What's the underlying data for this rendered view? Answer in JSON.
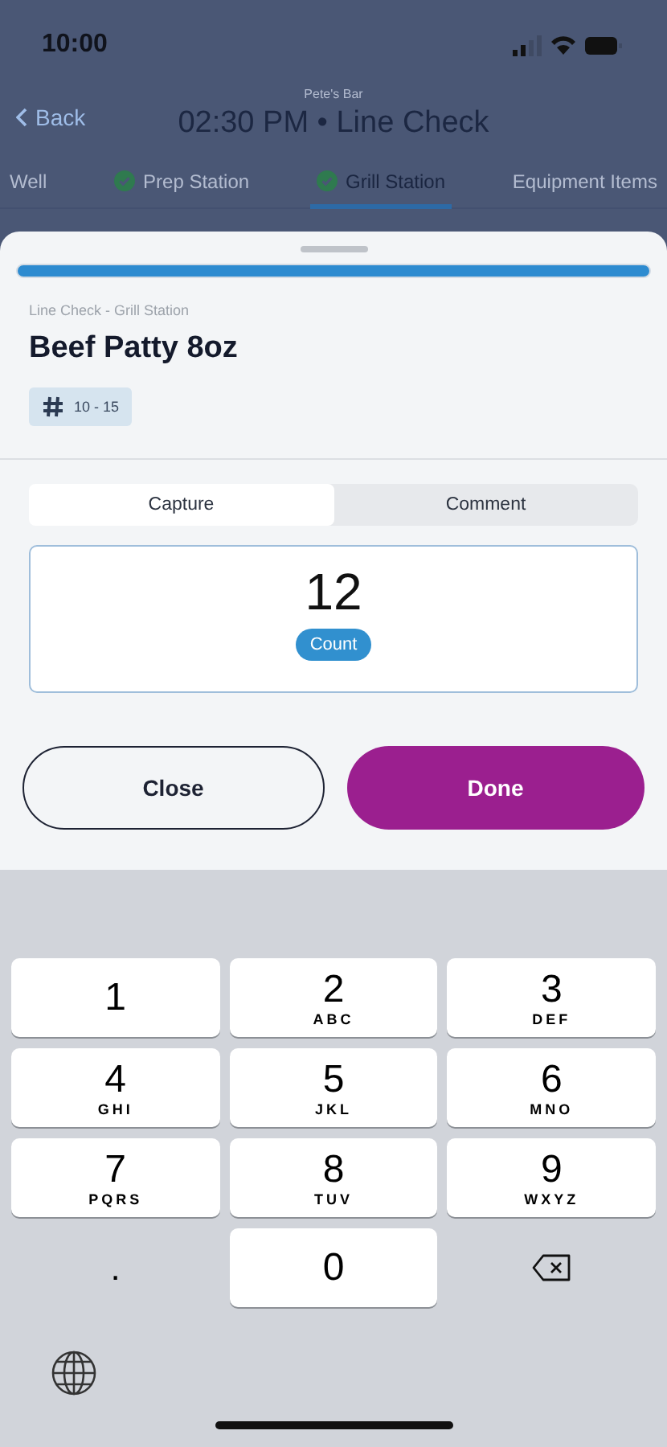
{
  "status_bar": {
    "time": "10:00"
  },
  "header": {
    "venue": "Pete's Bar",
    "back": "Back",
    "title": "02:30 PM • Line Check"
  },
  "tabs": [
    {
      "label": "Well",
      "done": false,
      "selected": false
    },
    {
      "label": "Prep Station",
      "done": true,
      "selected": false
    },
    {
      "label": "Grill Station",
      "done": true,
      "selected": true
    },
    {
      "label": "Equipment Items",
      "done": false,
      "selected": false
    }
  ],
  "sheet": {
    "progress": {
      "level": 1
    },
    "breadcrumb": "Line Check - Grill Station",
    "item": "Beef Patty 8oz",
    "range": "10 - 15",
    "segments": [
      {
        "label": "Capture",
        "selected": true
      },
      {
        "label": "Comment",
        "selected": false
      }
    ],
    "value": "12",
    "unit": "Count",
    "close": "Close",
    "done": "Done"
  },
  "keyboard": {
    "keys": [
      {
        "kind": "digit",
        "digit": "1"
      },
      {
        "kind": "digit",
        "digit": "2",
        "letters": "ABC"
      },
      {
        "kind": "digit",
        "digit": "3",
        "letters": "DEF"
      },
      {
        "kind": "digit",
        "digit": "4",
        "letters": "GHI"
      },
      {
        "kind": "digit",
        "digit": "5",
        "letters": "JKL"
      },
      {
        "kind": "digit",
        "digit": "6",
        "letters": "MNO"
      },
      {
        "kind": "digit",
        "digit": "7",
        "letters": "PQRS"
      },
      {
        "kind": "digit",
        "digit": "8",
        "letters": "TUV"
      },
      {
        "kind": "digit",
        "digit": "9",
        "letters": "WXYZ"
      },
      {
        "kind": "plain",
        "digit": "."
      },
      {
        "kind": "digit",
        "digit": "0"
      },
      {
        "kind": "backspace"
      }
    ]
  }
}
